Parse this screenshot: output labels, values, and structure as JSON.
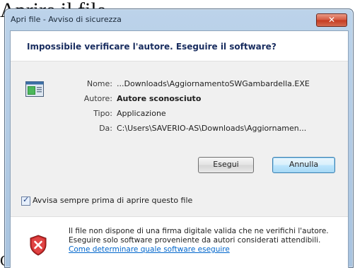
{
  "background": {
    "text_top": "Aprire il file",
    "text_bottom": "C"
  },
  "window": {
    "title": "Apri file - Avviso di sicurezza",
    "close_label": "✕"
  },
  "dialog": {
    "heading": "Impossibile verificare l'autore. Eseguire il software?",
    "fields": [
      {
        "label": "Nome:",
        "value": "...Downloads\\AggiornamentoSWGambardella.EXE"
      },
      {
        "label": "Autore:",
        "value": "Autore sconosciuto"
      },
      {
        "label": "Tipo:",
        "value": "Applicazione"
      },
      {
        "label": "Da:",
        "value": "C:\\Users\\SAVERIO-AS\\Downloads\\Aggiornamen..."
      }
    ],
    "run_label": "Esegui",
    "cancel_label": "Annulla",
    "checkbox_label": "Avvisa sempre prima di aprire questo file",
    "checkbox_checked": true,
    "info_line1": "Il file non dispone di una firma digitale valida che ne verifichi l'autore.",
    "info_line2": "Eseguire solo software proveniente da autori considerati attendibili.",
    "info_link": "Come determinare quale software eseguire"
  },
  "icons": {
    "app": "application-icon",
    "shield": "security-shield-icon",
    "close": "close-icon"
  },
  "colors": {
    "heading": "#1a2e60",
    "link": "#0066cc",
    "shield_red": "#c62828",
    "close_red": "#c43a20"
  }
}
